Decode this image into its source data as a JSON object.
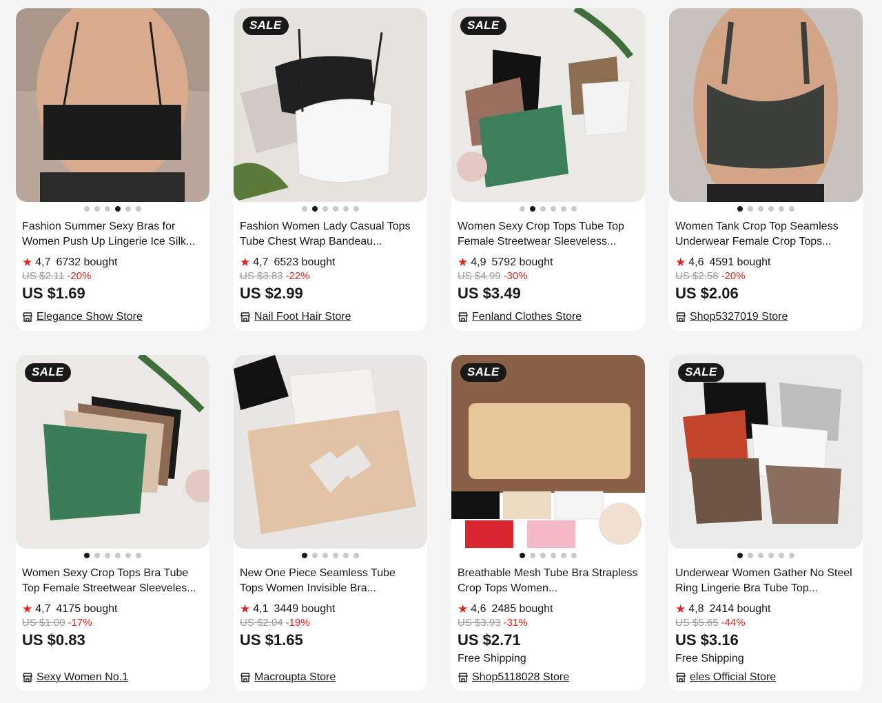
{
  "products": [
    {
      "title": "Fashion Summer Sexy Bras for Women Push Up Lingerie Ice Silk...",
      "rating": "4,7",
      "sold": "6732 bought",
      "original_price": "US $2.11",
      "discount": "-20%",
      "price": "US $1.69",
      "shipping": "",
      "store": "Elegance Show Store",
      "sale": false,
      "dots": 6,
      "active_dot": 3
    },
    {
      "title": "Fashion Women Lady Casual Tops Tube Chest Wrap Bandeau...",
      "rating": "4,7",
      "sold": "6523 bought",
      "original_price": "US $3.83",
      "discount": "-22%",
      "price": "US $2.99",
      "shipping": "",
      "store": "Nail Foot Hair Store",
      "sale": true,
      "sale_label": "SALE",
      "dots": 6,
      "active_dot": 1
    },
    {
      "title": "Women Sexy Crop Tops Tube Top Female Streetwear Sleeveless...",
      "rating": "4,9",
      "sold": "5792 bought",
      "original_price": "US $4.99",
      "discount": "-30%",
      "price": "US $3.49",
      "shipping": "",
      "store": "Fenland Clothes Store",
      "sale": true,
      "sale_label": "SALE",
      "dots": 6,
      "active_dot": 1
    },
    {
      "title": "Women Tank Crop Top Seamless Underwear Female Crop Tops...",
      "rating": "4,6",
      "sold": "4591 bought",
      "original_price": "US $2.58",
      "discount": "-20%",
      "price": "US $2.06",
      "shipping": "",
      "store": "Shop5327019 Store",
      "sale": false,
      "dots": 6,
      "active_dot": 0
    },
    {
      "title": "Women Sexy Crop Tops Bra Tube Top Female Streetwear Sleeveles...",
      "rating": "4,7",
      "sold": "4175 bought",
      "original_price": "US $1.00",
      "discount": "-17%",
      "price": "US $0.83",
      "shipping": "",
      "store": "Sexy Women No.1",
      "sale": true,
      "sale_label": "SALE",
      "dots": 6,
      "active_dot": 0
    },
    {
      "title": "New One Piece Seamless Tube Tops Women Invisible Bra...",
      "rating": "4,1",
      "sold": "3449 bought",
      "original_price": "US $2.04",
      "discount": "-19%",
      "price": "US $1.65",
      "shipping": "",
      "store": "Macroupta Store",
      "sale": false,
      "dots": 6,
      "active_dot": 0
    },
    {
      "title": "Breathable Mesh Tube Bra Strapless Crop Tops Women...",
      "rating": "4,6",
      "sold": "2485 bought",
      "original_price": "US $3.93",
      "discount": "-31%",
      "price": "US $2.71",
      "shipping": "Free Shipping",
      "store": "Shop5118028 Store",
      "sale": true,
      "sale_label": "SALE",
      "dots": 6,
      "active_dot": 0
    },
    {
      "title": "Underwear Women Gather No Steel Ring Lingerie Bra Tube Top...",
      "rating": "4,8",
      "sold": "2414 bought",
      "original_price": "US $5.65",
      "discount": "-44%",
      "price": "US $3.16",
      "shipping": "Free Shipping",
      "store": "eles Official Store",
      "sale": true,
      "sale_label": "SALE",
      "dots": 6,
      "active_dot": 0
    }
  ],
  "colors": {
    "accent": "#e1251b",
    "text": "#191919",
    "muted": "#999999",
    "background": "#f5f5f5"
  },
  "icons": {
    "rating": "star-icon",
    "store": "store-icon"
  }
}
